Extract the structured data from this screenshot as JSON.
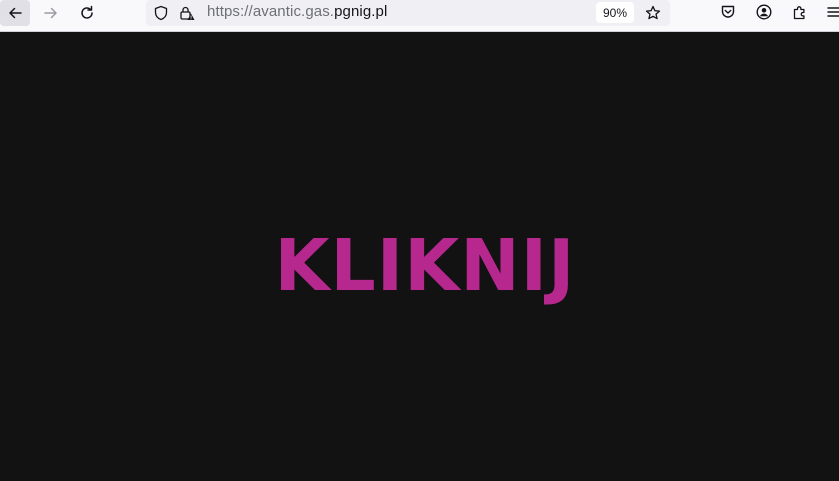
{
  "browser": {
    "url_prefix": "https://avantic.gas.",
    "url_host": "pgnig.pl",
    "zoom_label": "90%"
  },
  "page": {
    "cta_text": "KLIKNIJ"
  },
  "colors": {
    "page_background": "#131213",
    "cta_color": "#b7288f",
    "toolbar_background": "#f9f9fb"
  },
  "icons": [
    "back-arrow-icon",
    "forward-arrow-icon",
    "reload-icon",
    "shield-icon",
    "insecure-lock-icon",
    "bookmark-star-icon",
    "pocket-icon",
    "account-icon",
    "extensions-icon",
    "menu-icon"
  ]
}
